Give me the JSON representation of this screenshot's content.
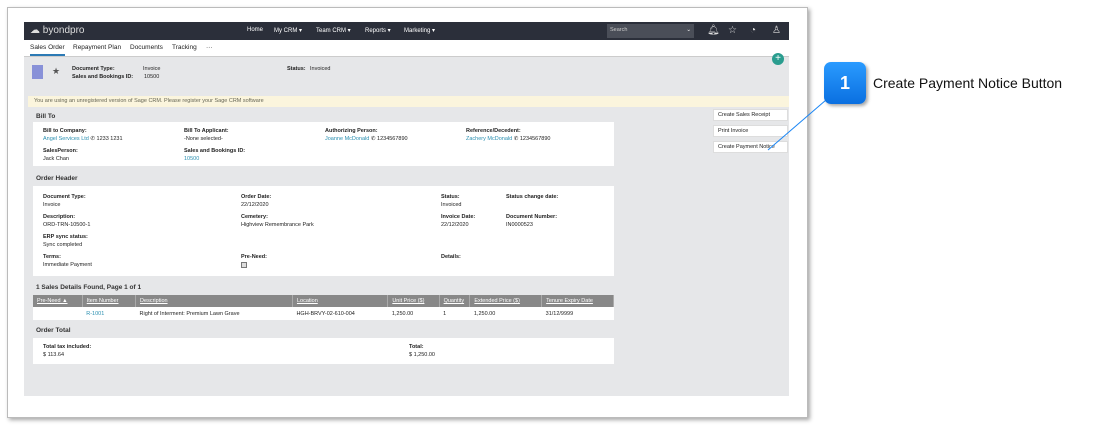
{
  "nav": {
    "brand": "byondpro",
    "items": [
      "Home",
      "My CRM ▾",
      "Team CRM ▾",
      "Reports ▾",
      "Marketing ▾"
    ],
    "search_placeholder": "Search"
  },
  "tabs": [
    "Sales Order",
    "Repayment Plan",
    "Documents",
    "Tracking",
    "···"
  ],
  "summary": {
    "doc_type_label": "Document Type:",
    "doc_type": "Invoice",
    "id_label": "Sales and Bookings ID:",
    "id": "10500",
    "status_label": "Status:",
    "status": "Invoiced"
  },
  "banner": "You are using an unregistered version of Sage CRM. Please register your Sage CRM software",
  "actions": [
    "Create Sales Receipt",
    "Print Invoice",
    "Create Payment Notice"
  ],
  "bill_to": {
    "title": "Bill To",
    "company_label": "Bill to Company:",
    "company": "Angel Services Ltd",
    "company_phone": "1233 1231",
    "applicant_label": "Bill To Applicant:",
    "applicant": "-None selected-",
    "auth_label": "Authorizing Person:",
    "auth": "Joanne McDonald",
    "auth_phone": "1234567890",
    "ref_label": "Reference/Decedent:",
    "ref": "Zachery McDonald",
    "ref_phone": "1234567890",
    "sales_label": "SalesPerson:",
    "sales": "Jack Chan",
    "sbid_label": "Sales and Bookings ID:",
    "sbid": "10500"
  },
  "order_header": {
    "title": "Order Header",
    "fields": [
      {
        "label": "Document Type:",
        "value": "Invoice"
      },
      {
        "label": "Order Date:",
        "value": "22/12/2020"
      },
      {
        "label": "Status:",
        "value": "Invoiced"
      },
      {
        "label": "Status change date:",
        "value": ""
      },
      {
        "label": "Description:",
        "value": "ORD-TRN-10500-1"
      },
      {
        "label": "Cemetery:",
        "value": "Highview Remembrance Park"
      },
      {
        "label": "Invoice Date:",
        "value": "22/12/2020"
      },
      {
        "label": "Document Number:",
        "value": "IN0000523"
      },
      {
        "label": "ERP sync status:",
        "value": "Sync completed"
      },
      {
        "label": "Terms:",
        "value": "Immediate Payment"
      },
      {
        "label": "Pre-Need:",
        "value": ""
      },
      {
        "label": "Details:",
        "value": ""
      }
    ]
  },
  "details": {
    "title": "1 Sales Details Found, Page 1 of 1",
    "columns": [
      "Pre-Need ▲",
      "Item Number",
      "Description",
      "Location",
      "Unit Price ($)",
      "Quantity",
      "Extended Price ($)",
      "Tenure Expiry Date"
    ],
    "rows": [
      [
        "",
        "R-1001",
        "Right of Interment: Premium Lawn Grave",
        "HGH-BRVY-02-610-004",
        "1,250.00",
        "1",
        "1,250.00",
        "31/12/9999"
      ]
    ]
  },
  "order_total": {
    "title": "Order Total",
    "tax_label": "Total tax included:",
    "tax": "$ 113.64",
    "total_label": "Total:",
    "total": "$ 1,250.00"
  },
  "callout": {
    "number": "1",
    "text": "Create Payment Notice Button",
    "color": "#1a86f5"
  }
}
